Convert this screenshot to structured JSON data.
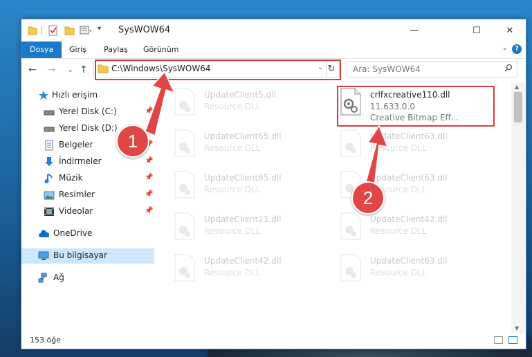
{
  "window": {
    "title": "SysWOW64",
    "controls": {
      "minimize": "—",
      "maximize": "☐",
      "close": "✕"
    }
  },
  "ribbon": {
    "tabs": [
      {
        "label": "Dosya",
        "active": true
      },
      {
        "label": "Giriş",
        "active": false
      },
      {
        "label": "Paylaş",
        "active": false
      },
      {
        "label": "Görünüm",
        "active": false
      }
    ],
    "help": "?"
  },
  "navigation": {
    "back": "←",
    "forward": "→",
    "recent": "⌄",
    "up": "↑",
    "address": "C:\\Windows\\SysWOW64",
    "refresh": "↻",
    "search_placeholder": "Ara: SysWOW64"
  },
  "sidebar": {
    "items": [
      {
        "label": "Hızlı erişim",
        "icon": "star-icon",
        "pinned": false
      },
      {
        "label": "Yerel Disk (C:)",
        "icon": "drive-icon",
        "pinned": true
      },
      {
        "label": "Yerel Disk (D:)",
        "icon": "drive-icon",
        "pinned": true
      },
      {
        "label": "Belgeler",
        "icon": "documents-icon",
        "pinned": true
      },
      {
        "label": "İndirmeler",
        "icon": "downloads-icon",
        "pinned": true
      },
      {
        "label": "Müzik",
        "icon": "music-icon",
        "pinned": true
      },
      {
        "label": "Resimler",
        "icon": "pictures-icon",
        "pinned": true
      },
      {
        "label": "Videolar",
        "icon": "videos-icon",
        "pinned": true
      },
      {
        "label": "OneDrive",
        "icon": "cloud-icon",
        "pinned": false
      },
      {
        "label": "Bu bilgisayar",
        "icon": "computer-icon",
        "pinned": false,
        "selected": true
      },
      {
        "label": "Ağ",
        "icon": "network-icon",
        "pinned": false
      }
    ]
  },
  "files": {
    "left_column": [
      {
        "name": "UpdateClient5.dll",
        "type": "Resource DLL"
      },
      {
        "name": "UpdateClient65.dll",
        "type": "Resource DLL"
      },
      {
        "name": "UpdateClient65.dll",
        "type": "Resource DLL"
      },
      {
        "name": "UpdateClient21.dll",
        "type": "Resource DLL"
      },
      {
        "name": "UpdateClient42.dll",
        "type": "Resource DLL"
      }
    ],
    "right_column": [
      {
        "name": "crlfxcreative110.dll",
        "version": "11.633.0.0",
        "type": "Creative Bitmap Eff...",
        "highlighted": true
      },
      {
        "name": "UpdateClient63.dll",
        "type": "Resource DLL"
      },
      {
        "name": "UpdateClient63.dll",
        "type": "Resource DLL"
      },
      {
        "name": "UpdateClient42.dll",
        "type": "Resource DLL"
      },
      {
        "name": "UpdateClient63.dll",
        "type": "Resource DLL"
      }
    ]
  },
  "status": {
    "count": "153 öğe"
  },
  "annotations": {
    "step1": "1",
    "step2": "2"
  },
  "colors": {
    "accent": "#1979ca",
    "highlight_red": "#e03b3b",
    "selected_bg": "#cce8ff"
  }
}
